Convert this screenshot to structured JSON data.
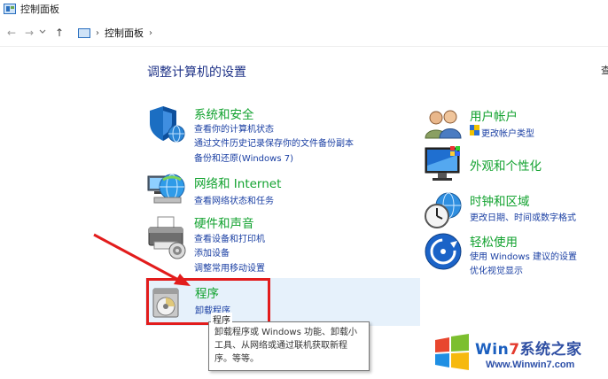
{
  "window": {
    "title": "控制面板"
  },
  "nav": {
    "back_label": "←",
    "forward_label": "→",
    "up_label": "↑",
    "address_separator": "›",
    "breadcrumb": "控制面板",
    "breadcrumb_trailing": "›"
  },
  "main": {
    "heading": "调整计算机的设置",
    "view_by_partial": "查"
  },
  "categories": {
    "system_security": {
      "title": "系统和安全",
      "links": [
        "查看你的计算机状态",
        "通过文件历史记录保存你的文件备份副本",
        "备份和还原(Windows 7)"
      ]
    },
    "network": {
      "title": "网络和 Internet",
      "links": [
        "查看网络状态和任务"
      ]
    },
    "hardware": {
      "title": "硬件和声音",
      "links": [
        "查看设备和打印机",
        "添加设备",
        "调整常用移动设置"
      ]
    },
    "programs": {
      "title": "程序",
      "links": [
        "卸载程序"
      ]
    },
    "user_accounts": {
      "title": "用户帐户",
      "links": [
        "更改帐户类型"
      ]
    },
    "appearance": {
      "title": "外观和个性化",
      "links": []
    },
    "clock_region": {
      "title": "时钟和区域",
      "links": [
        "更改日期、时间或数字格式"
      ]
    },
    "ease_access": {
      "title": "轻松使用",
      "links": [
        "使用 Windows 建议的设置",
        "优化视觉显示"
      ]
    }
  },
  "tooltip": {
    "title": "程序",
    "lines": [
      "卸载程序或 Windows 功能、卸载小",
      "工具、从网络或通过联机获取新程",
      "序。等等。"
    ]
  },
  "watermark": {
    "line1_win": "Win",
    "line1_seven": "7",
    "line1_rest": "系统之家",
    "line2": "Www.Winwin7.com"
  },
  "colors": {
    "category_title": "#12a22f",
    "link": "#1a3fa3",
    "heading": "#1e3287",
    "highlight_box": "#e21c1c",
    "hover_bg": "#e6f1fb"
  },
  "icons": {
    "system_security": "shield-icon",
    "network": "globe-network-icon",
    "hardware": "printer-icon",
    "programs": "program-disc-icon",
    "user_accounts": "users-icon",
    "appearance": "monitor-color-icon",
    "clock_region": "clock-globe-icon",
    "ease_access": "ease-of-access-icon"
  }
}
